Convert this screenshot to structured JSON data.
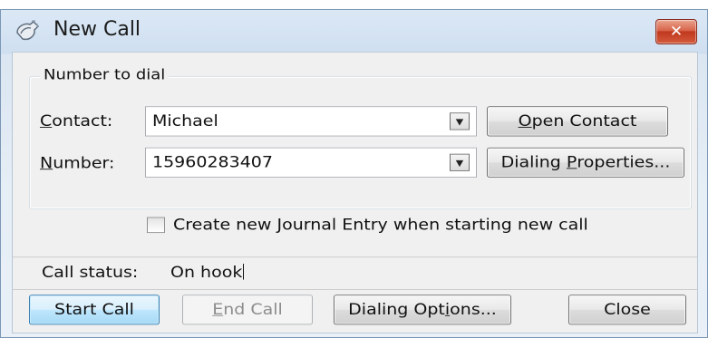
{
  "window": {
    "title": "New Call",
    "close_glyph": "✕"
  },
  "group": {
    "label": "Number to dial"
  },
  "contact": {
    "label_hotkey": "C",
    "label_rest": "ontact:",
    "value": "Michael"
  },
  "number": {
    "label_hotkey": "N",
    "label_rest": "umber:",
    "value": "15960283407"
  },
  "buttons": {
    "open_contact_hotkey": "O",
    "open_contact_rest": "pen Contact",
    "dialing_properties_pre": "Dialing ",
    "dialing_properties_hotkey": "P",
    "dialing_properties_post": "roperties...",
    "start_call": "Start Call",
    "end_call_hotkey": "E",
    "end_call_rest": "nd Call",
    "dialing_options_pre": "Dialing Opt",
    "dialing_options_hotkey": "i",
    "dialing_options_post": "ons...",
    "close": "Close"
  },
  "journal": {
    "label_pre": "Create new ",
    "label_hotkey": "J",
    "label_post": "ournal Entry when starting new call",
    "checked": false
  },
  "status": {
    "label": "Call status:",
    "value": "On hook"
  },
  "icons": {
    "phone": "phone-icon",
    "dropdown": "chevron-down-icon",
    "close": "close-icon"
  },
  "colors": {
    "close_button": "#c7432a",
    "default_button": "#3c7fb1"
  }
}
